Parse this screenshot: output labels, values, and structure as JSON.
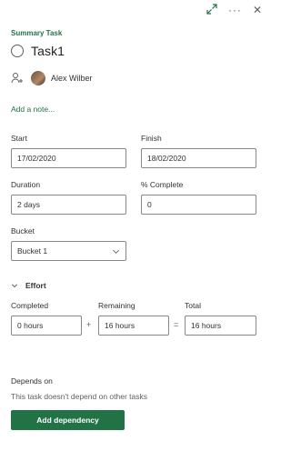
{
  "header": {
    "eyebrow": "Summary Task",
    "title": "Task1"
  },
  "assignee": {
    "name": "Alex Wilber"
  },
  "add_note_link": "Add a note...",
  "dates": {
    "start_label": "Start",
    "start_value": "17/02/2020",
    "finish_label": "Finish",
    "finish_value": "18/02/2020"
  },
  "progress": {
    "duration_label": "Duration",
    "duration_value": "2 days",
    "complete_label": "% Complete",
    "complete_value": "0"
  },
  "bucket": {
    "label": "Bucket",
    "value": "Bucket 1"
  },
  "effort": {
    "label": "Effort",
    "completed_label": "Completed",
    "completed_value": "0 hours",
    "remaining_label": "Remaining",
    "remaining_value": "16 hours",
    "total_label": "Total",
    "total_value": "16 hours",
    "plus": "+",
    "equals": "="
  },
  "dependencies": {
    "title": "Depends on",
    "empty_text": "This task doesn't depend on other tasks",
    "add_button": "Add dependency"
  },
  "colors": {
    "accent": "#217346",
    "border": "#8a8886"
  },
  "icons": [
    "expand-icon",
    "more-icon",
    "close-icon",
    "circle-icon",
    "person-icon",
    "chevron-down-icon"
  ]
}
